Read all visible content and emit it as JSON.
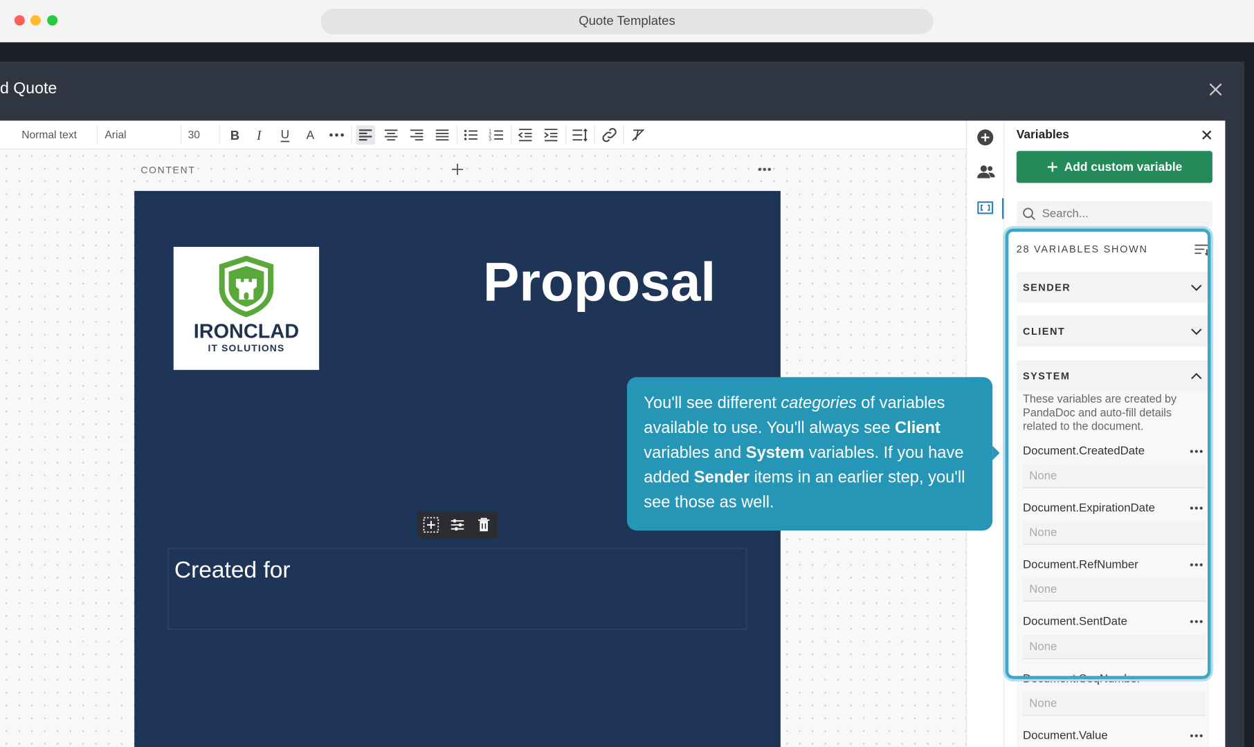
{
  "window": {
    "title": "Quote Templates"
  },
  "modal": {
    "title": "d Quote"
  },
  "toolbar": {
    "style": "Normal text",
    "font": "Arial",
    "size": "30"
  },
  "editor": {
    "content_label": "CONTENT",
    "proposal_title": "Proposal",
    "created_for": "Created for"
  },
  "logo": {
    "name": "IRONCLAD",
    "tagline": "IT SOLUTIONS"
  },
  "panel": {
    "title": "Variables",
    "add_button": "Add custom variable",
    "search_placeholder": "Search...",
    "shown_count": "28 VARIABLES SHOWN",
    "categories": [
      {
        "label": "SENDER"
      },
      {
        "label": "CLIENT"
      },
      {
        "label": "SYSTEM"
      }
    ],
    "system_description": "These variables are created by PandaDoc and auto-fill details related to the document.",
    "variables": [
      {
        "name": "Document.CreatedDate",
        "value": "None"
      },
      {
        "name": "Document.ExpirationDate",
        "value": "None"
      },
      {
        "name": "Document.RefNumber",
        "value": "None"
      },
      {
        "name": "Document.SentDate",
        "value": "None"
      },
      {
        "name": "Document.SeqNumber",
        "value": "None"
      },
      {
        "name": "Document.Value",
        "value": ""
      }
    ]
  },
  "tooltip": {
    "p1": "You'll see different ",
    "p1_em": "categories",
    "p2": " of variables available to use. You'll always see ",
    "p2_b": "Client",
    "p3": " variables and ",
    "p3_b": "System",
    "p4": " variables. If you have added ",
    "p4_b": "Sender",
    "p5": " items in an earlier step, you'll see those as well."
  },
  "colors": {
    "accent_green": "#248a5a",
    "tooltip_blue": "#2596b5",
    "page_navy": "#1f3557",
    "logo_green": "#5aa83a"
  }
}
